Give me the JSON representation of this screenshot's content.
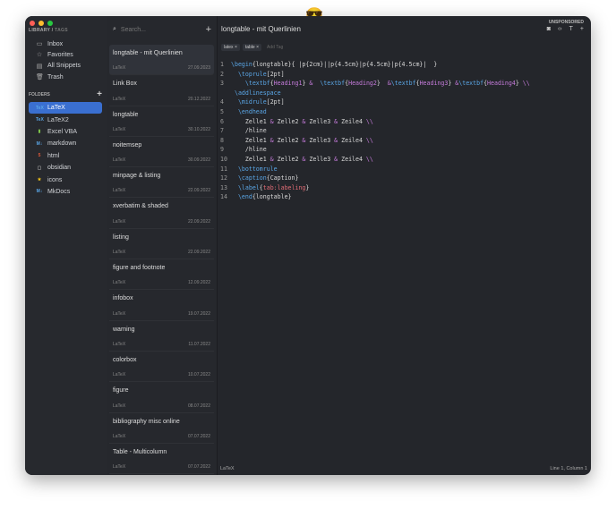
{
  "sidebar": {
    "tabs": [
      "LIBRARY",
      "/",
      "TAGS"
    ],
    "nav": [
      {
        "label": "Inbox",
        "icon": "inbox-icon",
        "g": "▭"
      },
      {
        "label": "Favorites",
        "icon": "star-icon",
        "g": "☆"
      },
      {
        "label": "All Snippets",
        "icon": "archive-icon",
        "g": "▤"
      },
      {
        "label": "Trash",
        "icon": "trash-icon",
        "g": "🗑"
      }
    ],
    "folders_header": "FOLDERS",
    "add": "+",
    "folders": [
      {
        "label": "LaTeX",
        "g": "TeX",
        "c": "#5aa6e6"
      },
      {
        "label": "LaTeX2",
        "g": "TeX",
        "c": "#5aa6e6"
      },
      {
        "label": "Excel VBA",
        "g": "▮",
        "c": "#7cc04a"
      },
      {
        "label": "markdown",
        "g": "M↓",
        "c": "#5aa6e6"
      },
      {
        "label": "html",
        "g": "5",
        "c": "#e05a3a"
      },
      {
        "label": "obsidian",
        "g": "▢",
        "c": "#aaa"
      },
      {
        "label": "icons",
        "g": "★",
        "c": "#f5c518"
      },
      {
        "label": "MkDocs",
        "g": "M↓",
        "c": "#5aa6e6"
      }
    ]
  },
  "list": {
    "search_placeholder": "Search...",
    "add": "+",
    "items": [
      [
        "longtable - mit Querlinien",
        "LaTeX",
        "27.09.2023"
      ],
      [
        "Link Box",
        "LaTeX",
        "20.12.2022"
      ],
      [
        "longtable",
        "LaTeX",
        "30.10.2022"
      ],
      [
        "noitemsep",
        "LaTeX",
        "30.09.2022"
      ],
      [
        "minpage & listing",
        "LaTeX",
        "22.09.2022"
      ],
      [
        "xverbatim & shaded",
        "LaTeX",
        "22.09.2022"
      ],
      [
        "listing",
        "LaTeX",
        "22.09.2022"
      ],
      [
        "figure and footnote",
        "LaTeX",
        "12.09.2022"
      ],
      [
        "infobox",
        "LaTeX",
        "19.07.2022"
      ],
      [
        "warning",
        "LaTeX",
        "11.07.2022"
      ],
      [
        "colorbox",
        "LaTeX",
        "10.07.2022"
      ],
      [
        "figure",
        "LaTeX",
        "08.07.2022"
      ],
      [
        "bibliography misc online",
        "LaTeX",
        "07.07.2022"
      ],
      [
        "Table - Multicolumn",
        "LaTeX",
        "07.07.2022"
      ]
    ]
  },
  "editor": {
    "title": "longtable - mit Querlinien",
    "unsponsored": "UNSPONSORED",
    "tools": [
      {
        "icon": "camera-icon",
        "g": "◙"
      },
      {
        "icon": "code-icon",
        "g": "‹›"
      },
      {
        "icon": "format-icon",
        "g": "T"
      },
      {
        "icon": "add-icon",
        "g": "+"
      }
    ],
    "tags": [
      "latex ×",
      "table ×"
    ],
    "add_tag": "Add Tag",
    "lines": [
      [
        "1",
        [
          [
            "c",
            "\\begin"
          ],
          [
            "",
            "{longtable}{ |p{2cm}||p{4.5cm}|p{4.5cm}|p{4.5cm}|  }"
          ]
        ]
      ],
      [
        "2",
        [
          [
            "",
            "  "
          ],
          [
            "c",
            "\\toprule"
          ],
          [
            "",
            "[2pt]"
          ]
        ]
      ],
      [
        "3",
        [
          [
            "",
            "    "
          ],
          [
            "c",
            "\\textbf"
          ],
          [
            "",
            "{"
          ],
          [
            "a",
            "Heading1"
          ],
          [
            "",
            "} "
          ],
          [
            "a",
            "&"
          ],
          [
            "",
            "  "
          ],
          [
            "c",
            "\\textbf"
          ],
          [
            "",
            "{"
          ],
          [
            "a",
            "Heading2"
          ],
          [
            "",
            "}  "
          ],
          [
            "a",
            "&"
          ],
          [
            "c",
            "\\textbf"
          ],
          [
            "",
            "{"
          ],
          [
            "a",
            "Heading3"
          ],
          [
            "",
            "} "
          ],
          [
            "a",
            "&"
          ],
          [
            "c",
            "\\textbf"
          ],
          [
            "",
            "{"
          ],
          [
            "a",
            "Heading4"
          ],
          [
            "",
            "} "
          ],
          [
            "a",
            "\\\\"
          ]
        ]
      ],
      [
        "",
        [
          [
            "c",
            " \\addlinespace"
          ]
        ]
      ],
      [
        "4",
        [
          [
            "",
            "  "
          ],
          [
            "c",
            "\\midrule"
          ],
          [
            "",
            "[2pt]"
          ]
        ]
      ],
      [
        "5",
        [
          [
            "",
            "  "
          ],
          [
            "c",
            "\\endhead"
          ]
        ]
      ],
      [
        "6",
        [
          [
            "",
            "    Zelle1 "
          ],
          [
            "a",
            "&"
          ],
          [
            "",
            " Zelle2 "
          ],
          [
            "a",
            "&"
          ],
          [
            "",
            " Zelle3 "
          ],
          [
            "a",
            "&"
          ],
          [
            "",
            " Zeile4 "
          ],
          [
            "a",
            "\\\\"
          ]
        ]
      ],
      [
        "7",
        [
          [
            "",
            "    /hline"
          ]
        ]
      ],
      [
        "8",
        [
          [
            "",
            "    Zelle1 "
          ],
          [
            "a",
            "&"
          ],
          [
            "",
            " Zelle2 "
          ],
          [
            "a",
            "&"
          ],
          [
            "",
            " Zelle3 "
          ],
          [
            "a",
            "&"
          ],
          [
            "",
            " Zeile4 "
          ],
          [
            "a",
            "\\\\"
          ]
        ]
      ],
      [
        "9",
        [
          [
            "",
            "    /hline"
          ]
        ]
      ],
      [
        "10",
        [
          [
            "",
            "    Zelle1 "
          ],
          [
            "a",
            "&"
          ],
          [
            "",
            " Zelle2 "
          ],
          [
            "a",
            "&"
          ],
          [
            "",
            " Zelle3 "
          ],
          [
            "a",
            "&"
          ],
          [
            "",
            " Zeile4 "
          ],
          [
            "a",
            "\\\\"
          ]
        ]
      ],
      [
        "11",
        [
          [
            "",
            "  "
          ],
          [
            "c",
            "\\bottomrule"
          ]
        ]
      ],
      [
        "12",
        [
          [
            "",
            "  "
          ],
          [
            "c",
            "\\caption"
          ],
          [
            "",
            "{Caption}"
          ]
        ]
      ],
      [
        "13",
        [
          [
            "",
            "  "
          ],
          [
            "c",
            "\\label"
          ],
          [
            "",
            "{"
          ],
          [
            "r",
            "tab:labeling"
          ],
          [
            "",
            "}"
          ]
        ]
      ],
      [
        "14",
        [
          [
            "",
            "  "
          ],
          [
            "c",
            "\\end"
          ],
          [
            "",
            "{longtable}"
          ]
        ]
      ]
    ],
    "status_language": "LaTeX",
    "status_position": "Line 1, Column 1"
  },
  "colors": {
    "accent": "#3a6fd0",
    "background": "#24262b"
  }
}
